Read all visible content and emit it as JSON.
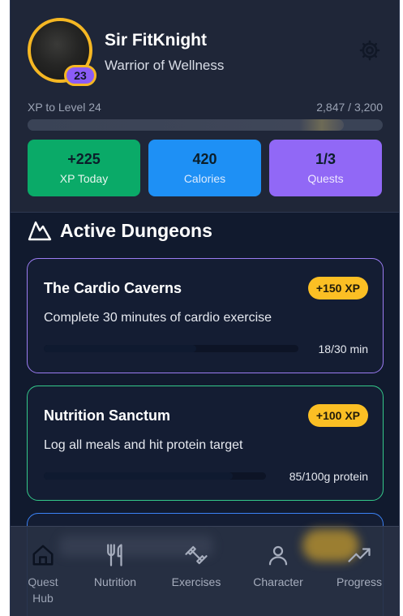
{
  "profile": {
    "name": "Sir FitKnight",
    "title": "Warrior of Wellness",
    "level": "23",
    "xp_label": "XP to Level 24",
    "xp_value": "2,847 / 3,200",
    "xp_progress": 0.89
  },
  "stats": [
    {
      "value": "+225",
      "label": "XP Today"
    },
    {
      "value": "420",
      "label": "Calories"
    },
    {
      "value": "1/3",
      "label": "Quests"
    }
  ],
  "section": {
    "title": "Active Dungeons"
  },
  "dungeons": [
    {
      "name": "The Cardio Caverns",
      "reward": "+150 XP",
      "description": "Complete 30 minutes of cardio exercise",
      "progress_text": "18/30 min",
      "progress": 0.6
    },
    {
      "name": "Nutrition Sanctum",
      "reward": "+100 XP",
      "description": "Log all meals and hit protein target",
      "progress_text": "85/100g protein",
      "progress": 0.85
    }
  ],
  "nav": [
    {
      "label": "Quest Hub",
      "icon": "home-icon",
      "active": true
    },
    {
      "label": "Nutrition",
      "icon": "utensils-icon",
      "active": false
    },
    {
      "label": "Exercises",
      "icon": "dumbbell-icon",
      "active": false
    },
    {
      "label": "Character",
      "icon": "user-icon",
      "active": false
    },
    {
      "label": "Progress",
      "icon": "trending-up-icon",
      "active": false
    }
  ],
  "colors": {
    "background": "#111a2e",
    "accent_gold": "#f5b723",
    "xp_green": "#0aaa68",
    "calories_blue": "#1e90f5",
    "quests_purple": "#9168f6"
  }
}
